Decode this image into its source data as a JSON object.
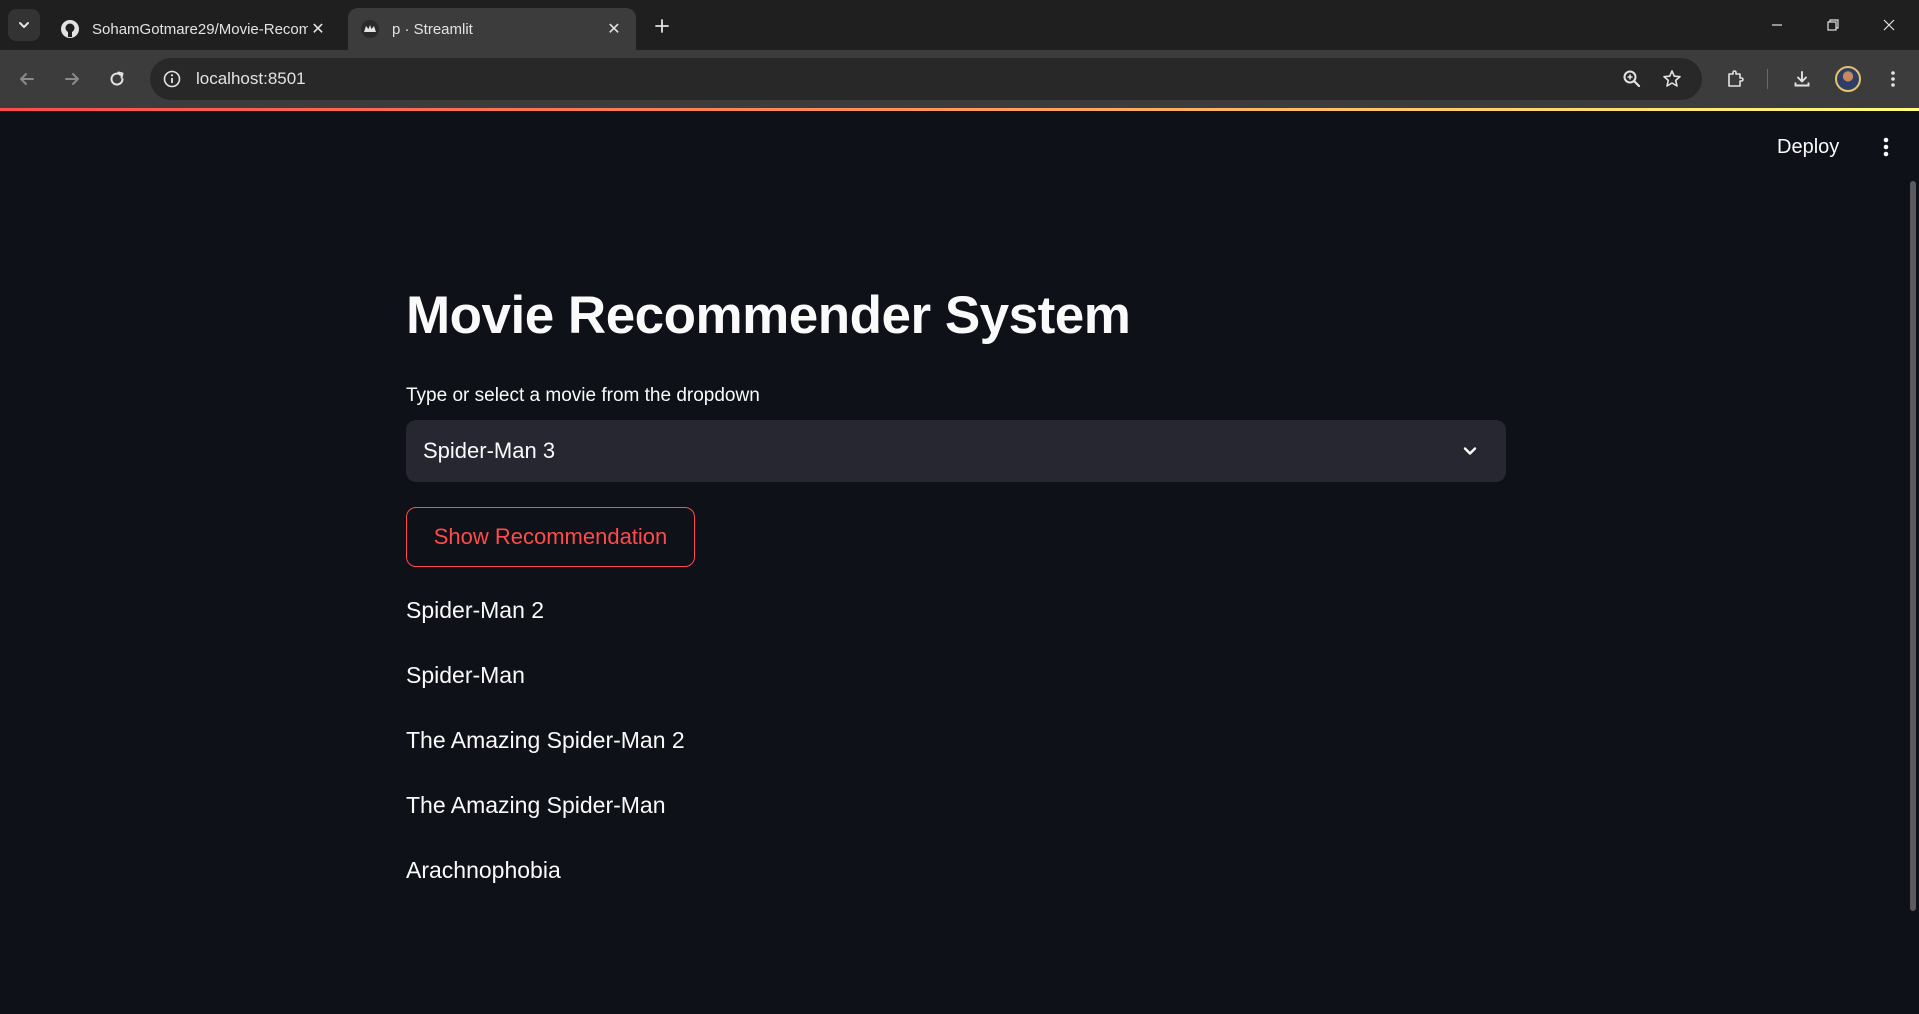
{
  "browser": {
    "tabs": [
      {
        "title": "SohamGotmare29/Movie-Recom",
        "favicon": "github-icon",
        "active": false
      },
      {
        "title": "p · Streamlit",
        "favicon": "streamlit-crown-icon",
        "active": true
      }
    ],
    "url": "localhost:8501"
  },
  "header": {
    "deploy_label": "Deploy"
  },
  "main": {
    "title": "Movie Recommender System",
    "select_label": "Type or select a movie from the dropdown",
    "selected_movie": "Spider-Man 3",
    "button_label": "Show Recommendation",
    "recommendations": [
      "Spider-Man 2",
      "Spider-Man",
      "The Amazing Spider-Man 2",
      "The Amazing Spider-Man",
      "Arachnophobia"
    ]
  },
  "colors": {
    "background": "#0e1117",
    "select_bg": "#262730",
    "accent": "#ff4b4b",
    "text": "#fafafa"
  }
}
